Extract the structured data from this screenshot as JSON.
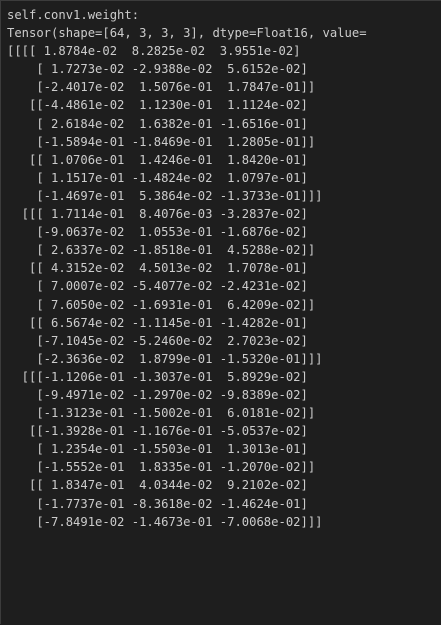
{
  "output": {
    "lines": [
      "self.conv1.weight:",
      "Tensor(shape=[64, 3, 3, 3], dtype=Float16, value=",
      "[[[[ 1.8784e-02  8.2825e-02  3.9551e-02]",
      "    [ 1.7273e-02 -2.9388e-02  5.6152e-02]",
      "    [-2.4017e-02  1.5076e-01  1.7847e-01]]",
      "   [[-4.4861e-02  1.1230e-01  1.1124e-02]",
      "    [ 2.6184e-02  1.6382e-01 -1.6516e-01]",
      "    [-1.5894e-01 -1.8469e-01  1.2805e-01]]",
      "   [[ 1.0706e-01  1.4246e-01  1.8420e-01]",
      "    [ 1.1517e-01 -1.4824e-02  1.0797e-01]",
      "    [-1.4697e-01  5.3864e-02 -1.3733e-01]]]",
      "  [[[ 1.7114e-01  8.4076e-03 -3.2837e-02]",
      "    [-9.0637e-02  1.0553e-01 -1.6876e-02]",
      "    [ 2.6337e-02 -1.8518e-01  4.5288e-02]]",
      "   [[ 4.3152e-02  4.5013e-02  1.7078e-01]",
      "    [ 7.0007e-02 -5.4077e-02 -2.4231e-02]",
      "    [ 7.6050e-02 -1.6931e-01  6.4209e-02]]",
      "   [[ 6.5674e-02 -1.1145e-01 -1.4282e-01]",
      "    [-7.1045e-02 -5.2460e-02  2.7023e-02]",
      "    [-2.3636e-02  1.8799e-01 -1.5320e-01]]]",
      "  [[[-1.1206e-01 -1.3037e-01  5.8929e-02]",
      "    [-9.4971e-02 -1.2970e-02 -9.8389e-02]",
      "    [-1.3123e-01 -1.5002e-01  6.0181e-02]]",
      "   [[-1.3928e-01 -1.1676e-01 -5.0537e-02]",
      "    [ 1.2354e-01 -1.5503e-01  1.3013e-01]",
      "    [-1.5552e-01  1.8335e-01 -1.2070e-02]]",
      "   [[ 1.8347e-01  4.0344e-02  9.2102e-02]",
      "    [-1.7737e-01 -8.3618e-02 -1.4624e-01]",
      "    [-7.8491e-02 -1.4673e-01 -7.0068e-02]]]"
    ]
  }
}
